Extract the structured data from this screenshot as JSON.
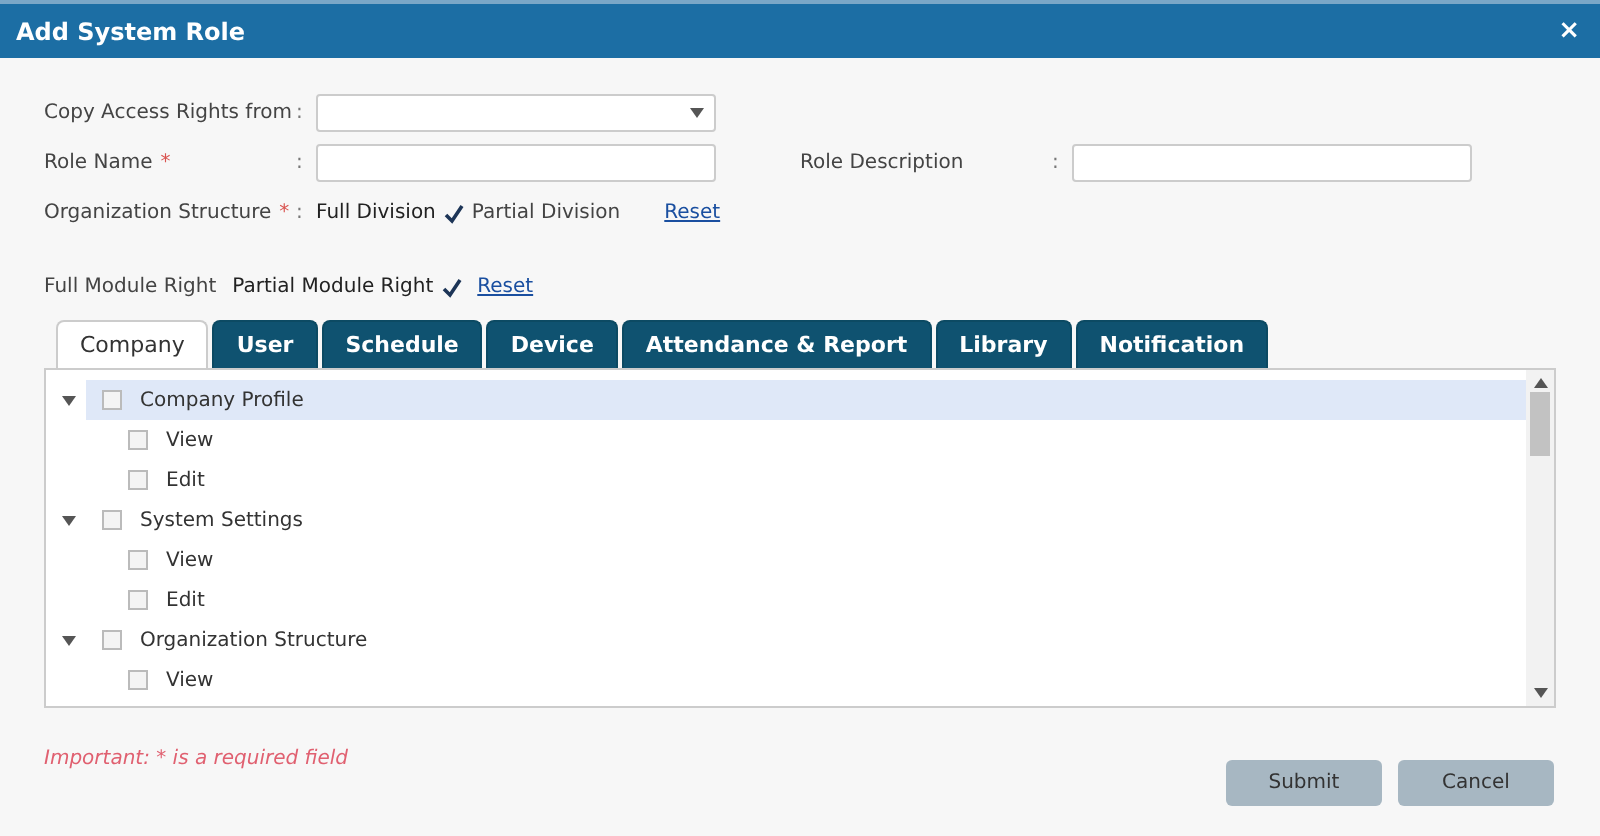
{
  "window": {
    "title": "Add System Role",
    "close": "×"
  },
  "form": {
    "copy_from": {
      "label": "Copy Access Rights from",
      "separator": ":"
    },
    "role_name": {
      "label": "Role Name",
      "required_mark": "*",
      "separator": ":"
    },
    "role_description": {
      "label": "Role Description",
      "separator": ":"
    },
    "org_structure": {
      "label": "Organization Structure",
      "required_mark": "*",
      "separator": ":",
      "options": [
        {
          "label": "Full Division",
          "selected": true
        },
        {
          "label": "Partial Division",
          "selected": false
        }
      ],
      "reset": "Reset"
    }
  },
  "module_rights": {
    "options": [
      {
        "label": "Full Module Right",
        "selected": false
      },
      {
        "label": "Partial Module Right",
        "selected": true
      }
    ],
    "reset": "Reset"
  },
  "tabs": [
    {
      "label": "Company",
      "selected": true
    },
    {
      "label": "User",
      "selected": false
    },
    {
      "label": "Schedule",
      "selected": false
    },
    {
      "label": "Device",
      "selected": false
    },
    {
      "label": "Attendance & Report",
      "selected": false
    },
    {
      "label": "Library",
      "selected": false
    },
    {
      "label": "Notification",
      "selected": false
    }
  ],
  "tree": [
    {
      "label": "Company Profile",
      "expanded": true,
      "checked": false,
      "selected": true,
      "children": [
        {
          "label": "View",
          "checked": false,
          "selected": false
        },
        {
          "label": "Edit",
          "checked": false,
          "selected": false
        }
      ]
    },
    {
      "label": "System Settings",
      "expanded": true,
      "checked": false,
      "selected": false,
      "children": [
        {
          "label": "View",
          "checked": false,
          "selected": false
        },
        {
          "label": "Edit",
          "checked": false,
          "selected": false
        }
      ]
    },
    {
      "label": "Organization Structure",
      "expanded": true,
      "checked": false,
      "selected": false,
      "children": [
        {
          "label": "View",
          "checked": false,
          "selected": false
        }
      ]
    }
  ],
  "note": "Important: * is a required field",
  "buttons": [
    "Submit",
    "Cancel"
  ]
}
